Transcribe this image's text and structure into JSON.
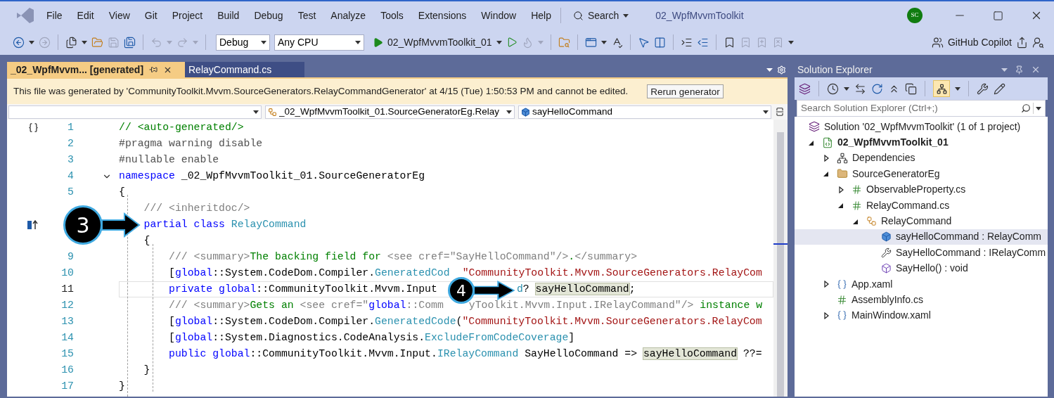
{
  "menu": [
    "File",
    "Edit",
    "View",
    "Git",
    "Project",
    "Build",
    "Debug",
    "Test",
    "Analyze",
    "Tools",
    "Extensions",
    "Window",
    "Help"
  ],
  "search": {
    "label": "Search"
  },
  "window": {
    "title": "02_WpfMvvmToolkit",
    "avatar": "SC"
  },
  "toolbar": {
    "configuration": "Debug",
    "platform": "Any CPU",
    "startup": "02_WpfMvvmToolkit_01",
    "copilot": "GitHub Copilot"
  },
  "tabs": [
    {
      "label": "_02_WpfMvvm... [generated]",
      "selected": true
    },
    {
      "label": "RelayCommand.cs",
      "selected": false
    }
  ],
  "infobar": {
    "message": "This file was generated by 'CommunityToolkit.Mvvm.SourceGenerators.RelayCommandGenerator' at 4/15 (Tue) 1:50:53 PM and cannot be edited.",
    "button": "Rerun generator"
  },
  "navigation": {
    "type": "_02_WpfMvvmToolkit_01.SourceGeneratorEg.Relay",
    "member": "sayHelloCommand"
  },
  "code": [
    {
      "number": "1",
      "current": false,
      "tokens": [
        {
          "kind": "comment",
          "text": "// <auto-generated/>"
        }
      ]
    },
    {
      "number": "2",
      "current": false,
      "tokens": [
        {
          "kind": "preproc",
          "text": "#pragma warning disable"
        }
      ]
    },
    {
      "number": "3",
      "current": false,
      "tokens": [
        {
          "kind": "preproc",
          "text": "#nullable enable"
        }
      ]
    },
    {
      "number": "4",
      "current": false,
      "foldable": true,
      "tokens": [
        {
          "kind": "keyword",
          "text": "namespace"
        },
        {
          "kind": "plain",
          "text": " _02_WpfMvvmToolkit_01.SourceGeneratorEg"
        }
      ]
    },
    {
      "number": "5",
      "current": false,
      "tokens": [
        {
          "kind": "plain",
          "text": "{"
        }
      ]
    },
    {
      "current": false,
      "tokens": [
        {
          "kind": "doc",
          "text": "    /// <inheritdoc/>"
        }
      ]
    },
    {
      "current": false,
      "tokens": [
        {
          "kind": "keyword",
          "text": "    partial class "
        },
        {
          "kind": "type",
          "text": "RelayCommand"
        }
      ]
    },
    {
      "current": false,
      "tokens": [
        {
          "kind": "plain",
          "text": "    {"
        }
      ]
    },
    {
      "number": "9",
      "current": false,
      "tokens": [
        {
          "kind": "doc",
          "text": "        /// <summary>"
        },
        {
          "kind": "comment",
          "text": "The backing field for "
        },
        {
          "kind": "doc",
          "text": "<see cref=\"SayHelloCommand\"/>"
        },
        {
          "kind": "comment",
          "text": "."
        },
        {
          "kind": "doc",
          "text": "</summary>"
        }
      ]
    },
    {
      "number": "10",
      "current": false,
      "tokens": [
        {
          "kind": "plain",
          "text": "        ["
        },
        {
          "kind": "keyword",
          "text": "global"
        },
        {
          "kind": "plain",
          "text": "::System.CodeDom.Compiler."
        },
        {
          "kind": "type",
          "text": "GeneratedCod"
        },
        {
          "kind": "covered"
        },
        {
          "kind": "string",
          "text": "\"CommunityToolkit.Mvvm.SourceGenerators.RelayCom"
        }
      ]
    },
    {
      "number": "11",
      "current": true,
      "tokens": [
        {
          "kind": "keyword",
          "text": "        private global"
        },
        {
          "kind": "plain",
          "text": "::CommunityToolkit.Mvvm.Input"
        },
        {
          "kind": "covered"
        },
        {
          "kind": "type",
          "text": "d"
        },
        {
          "kind": "plain",
          "text": "? "
        },
        {
          "kind": "reference",
          "text": "sayHelloCommand"
        },
        {
          "kind": "plain",
          "text": ";"
        }
      ]
    },
    {
      "number": "12",
      "current": false,
      "tokens": [
        {
          "kind": "doc",
          "text": "        /// <summary>"
        },
        {
          "kind": "comment",
          "text": "Gets an "
        },
        {
          "kind": "doc",
          "text": "<see cref=\""
        },
        {
          "kind": "keyword",
          "text": "global"
        },
        {
          "kind": "doc",
          "text": "::Comm"
        },
        {
          "kind": "covered"
        },
        {
          "kind": "doc",
          "text": "yToolkit.Mvvm.Input.IRelayCommand\"/>"
        },
        {
          "kind": "comment",
          "text": " instance w"
        }
      ]
    },
    {
      "number": "13",
      "current": false,
      "tokens": [
        {
          "kind": "plain",
          "text": "        ["
        },
        {
          "kind": "keyword",
          "text": "global"
        },
        {
          "kind": "plain",
          "text": "::System.CodeDom.Compiler."
        },
        {
          "kind": "type",
          "text": "GeneratedCode"
        },
        {
          "kind": "plain",
          "text": "("
        },
        {
          "kind": "string",
          "text": "\"CommunityToolkit.Mvvm.SourceGenerators.RelayCom"
        }
      ]
    },
    {
      "number": "14",
      "current": false,
      "tokens": [
        {
          "kind": "plain",
          "text": "        ["
        },
        {
          "kind": "keyword",
          "text": "global"
        },
        {
          "kind": "plain",
          "text": "::System.Diagnostics.CodeAnalysis."
        },
        {
          "kind": "type",
          "text": "ExcludeFromCodeCoverage"
        },
        {
          "kind": "plain",
          "text": "]"
        }
      ]
    },
    {
      "number": "15",
      "current": false,
      "tokens": [
        {
          "kind": "keyword",
          "text": "        public global"
        },
        {
          "kind": "plain",
          "text": "::CommunityToolkit.Mvvm.Input."
        },
        {
          "kind": "type",
          "text": "IRelayCommand"
        },
        {
          "kind": "plain",
          "text": " SayHelloCommand => "
        },
        {
          "kind": "reference",
          "text": "sayHelloCommand"
        },
        {
          "kind": "plain",
          "text": " ??="
        }
      ]
    },
    {
      "number": "16",
      "current": false,
      "tokens": [
        {
          "kind": "plain",
          "text": "    }"
        }
      ]
    },
    {
      "number": "17",
      "current": false,
      "tokens": [
        {
          "kind": "plain",
          "text": "}"
        }
      ]
    }
  ],
  "callouts": [
    {
      "label": "3"
    },
    {
      "label": "4"
    }
  ],
  "solution_explorer": {
    "title": "Solution Explorer",
    "search": {
      "placeholder": "Search Solution Explorer (Ctrl+;)"
    },
    "tree": [
      {
        "label": "Solution '02_WpfMvvmToolkit' (1 of 1 project)",
        "kind": "solution",
        "selected": false,
        "children": [
          {
            "label": "02_WpfMvvmToolkit_01",
            "kind": "project",
            "expanded": true,
            "selected": false,
            "children": [
              {
                "label": "Dependencies",
                "kind": "dependencies",
                "expanded": false,
                "selected": false
              },
              {
                "label": "SourceGeneratorEg",
                "kind": "folder",
                "expanded": true,
                "selected": false,
                "children": [
                  {
                    "label": "ObservableProperty.cs",
                    "kind": "csharp",
                    "expanded": false,
                    "selected": false
                  },
                  {
                    "label": "RelayCommand.cs",
                    "kind": "csharp",
                    "expanded": true,
                    "selected": false,
                    "children": [
                      {
                        "label": "RelayCommand",
                        "kind": "class",
                        "expanded": true,
                        "selected": false,
                        "children": [
                          {
                            "label": "sayHelloCommand : RelayComm",
                            "kind": "field",
                            "selected": true
                          },
                          {
                            "label": "SayHelloCommand : IRelayComm",
                            "kind": "property",
                            "selected": false
                          },
                          {
                            "label": "SayHello() : void",
                            "kind": "method",
                            "selected": false
                          }
                        ]
                      }
                    ]
                  }
                ]
              },
              {
                "label": "App.xaml",
                "kind": "xaml",
                "expanded": false,
                "selected": false
              },
              {
                "label": "AssemblyInfo.cs",
                "kind": "csharp",
                "selected": false
              },
              {
                "label": "MainWindow.xaml",
                "kind": "xaml",
                "expanded": false,
                "selected": false
              }
            ]
          }
        ]
      }
    ]
  }
}
